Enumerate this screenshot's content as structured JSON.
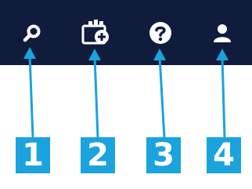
{
  "toolbar": {
    "background": "#101c3c",
    "icon_color": "#ffffff",
    "items": [
      {
        "icon": "search-icon"
      },
      {
        "icon": "add-item-icon"
      },
      {
        "icon": "help-icon"
      },
      {
        "icon": "user-icon"
      }
    ]
  },
  "callouts": {
    "color": "#1aa3dd",
    "labels": [
      "1",
      "2",
      "3",
      "4"
    ]
  }
}
